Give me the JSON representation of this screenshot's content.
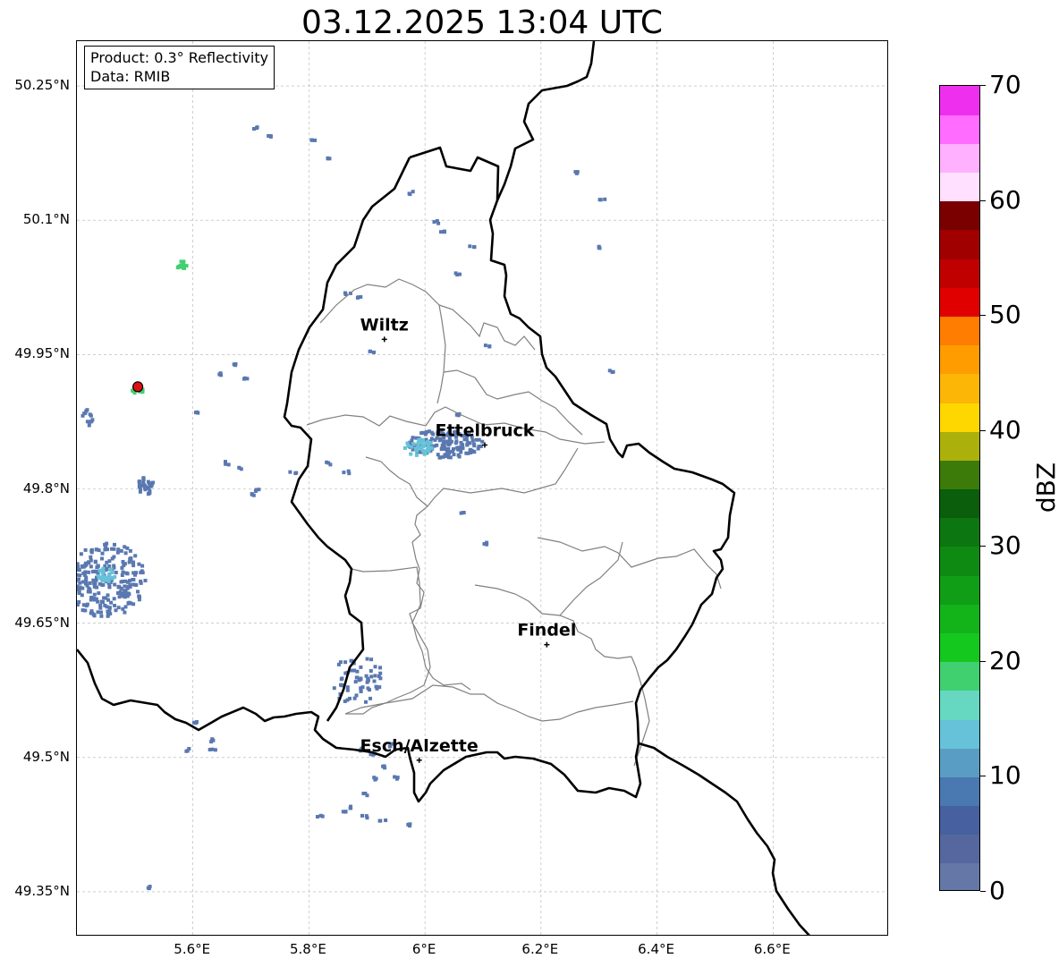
{
  "title": "03.12.2025 13:04 UTC",
  "info_box": {
    "product": "Product: 0.3° Reflectivity",
    "source": "Data: RMIB"
  },
  "lat_ticks": [
    {
      "value": 50.25,
      "label": "50.25°N"
    },
    {
      "value": 50.1,
      "label": "50.1°N"
    },
    {
      "value": 49.95,
      "label": "49.95°N"
    },
    {
      "value": 49.8,
      "label": "49.8°N"
    },
    {
      "value": 49.65,
      "label": "49.65°N"
    },
    {
      "value": 49.5,
      "label": "49.5°N"
    },
    {
      "value": 49.35,
      "label": "49.35°N"
    }
  ],
  "lon_ticks": [
    {
      "value": 5.6,
      "label": "5.6°E"
    },
    {
      "value": 5.8,
      "label": "5.8°E"
    },
    {
      "value": 6.0,
      "label": "6°E"
    },
    {
      "value": 6.2,
      "label": "6.2°E"
    },
    {
      "value": 6.4,
      "label": "6.4°E"
    },
    {
      "value": 6.6,
      "label": "6.6°E"
    }
  ],
  "extent": {
    "lon_min": 5.4,
    "lon_max": 6.8,
    "lat_min": 49.3,
    "lat_max": 50.3
  },
  "cities": [
    {
      "name": "Wiltz",
      "lon": 5.93,
      "lat": 49.967
    },
    {
      "name": "Ettelbruck",
      "lon": 6.103,
      "lat": 49.849
    },
    {
      "name": "Findel",
      "lon": 6.21,
      "lat": 49.626
    },
    {
      "name": "Esch/Alzette",
      "lon": 5.99,
      "lat": 49.497
    }
  ],
  "radar_site": {
    "lon": 5.505,
    "lat": 49.914,
    "color": "#dd1111"
  },
  "colorbar": {
    "label": "dBZ",
    "min": 0,
    "max": 70,
    "tick_values": [
      0,
      10,
      20,
      30,
      40,
      50,
      60,
      70
    ],
    "tick_labels": [
      "0",
      "10",
      "20",
      "30",
      "40",
      "50",
      "60",
      "70"
    ],
    "colors": [
      "#6477a6",
      "#55679e",
      "#4660a0",
      "#4a78b0",
      "#5a9dc4",
      "#66c2d8",
      "#66d8c2",
      "#40d070",
      "#14c81e",
      "#12b41a",
      "#109e16",
      "#0e8a12",
      "#0c7610",
      "#0a5e0c",
      "#3c7a0a",
      "#acb00a",
      "#ffd700",
      "#fbb606",
      "#ff9c00",
      "#ff7d00",
      "#e00000",
      "#c00000",
      "#a00000",
      "#7a0000",
      "#ffe0ff",
      "#ffb0ff",
      "#ff6cff",
      "#ee30ee"
    ]
  },
  "colors": {
    "border": "#000000",
    "canton_lines": "#808080",
    "grid": "#b0b0b0",
    "echo_low": "#5a78b0",
    "echo_mid": "#66c2d8",
    "echo_green": "#40d070"
  }
}
